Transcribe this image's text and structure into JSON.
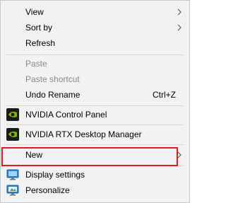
{
  "context_menu": {
    "items": [
      {
        "label": "View",
        "submenu": true
      },
      {
        "label": "Sort by",
        "submenu": true
      },
      {
        "label": "Refresh"
      },
      {
        "label": "Paste",
        "disabled": true
      },
      {
        "label": "Paste shortcut",
        "disabled": true
      },
      {
        "label": "Undo Rename",
        "shortcut": "Ctrl+Z"
      },
      {
        "label": "NVIDIA Control Panel",
        "icon": "nvidia-icon"
      },
      {
        "label": "NVIDIA RTX Desktop Manager",
        "icon": "nvidia-icon"
      },
      {
        "label": "New",
        "submenu": true
      },
      {
        "label": "Display settings",
        "icon": "display-icon",
        "highlighted": true
      },
      {
        "label": "Personalize",
        "icon": "personalize-icon"
      }
    ]
  },
  "colors": {
    "menu_background": "#f2f2f2",
    "disabled_text": "#8a8a8a",
    "highlight_border": "#e01b24",
    "nvidia_green": "#76b900"
  }
}
